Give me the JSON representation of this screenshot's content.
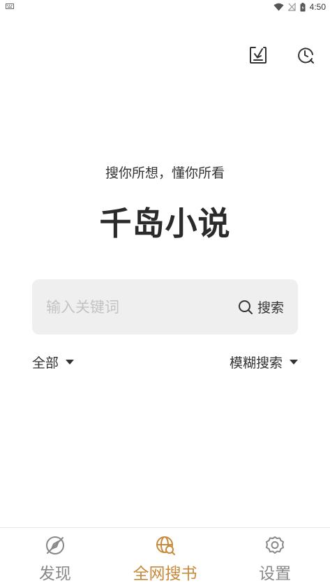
{
  "status_bar": {
    "time": "4:50"
  },
  "top_actions": {
    "import_icon": "download-box-icon",
    "history_icon": "clock-history-icon"
  },
  "hero": {
    "slogan": "搜你所想，懂你所看",
    "app_name": "千岛小说"
  },
  "search": {
    "placeholder": "输入关键词",
    "value": "",
    "button_label": "搜索",
    "button_icon": "search-icon"
  },
  "filters": {
    "scope": "全部",
    "mode": "模糊搜索"
  },
  "bottom_nav": {
    "items": [
      {
        "label": "发现",
        "icon": "compass-off-icon",
        "active": false
      },
      {
        "label": "全网搜书",
        "icon": "globe-search-icon",
        "active": true
      },
      {
        "label": "设置",
        "icon": "gear-icon",
        "active": false
      }
    ]
  },
  "colors": {
    "accent": "#c8893b",
    "inactive": "#888888",
    "search_bg": "#efefef",
    "text": "#333333"
  }
}
